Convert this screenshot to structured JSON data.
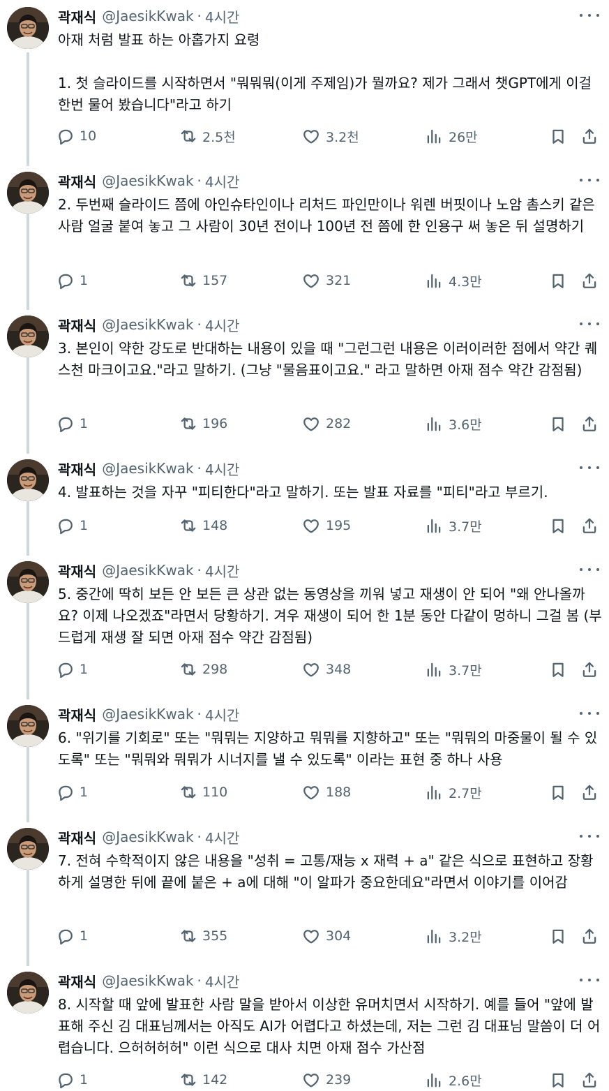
{
  "author": {
    "name": "곽재식",
    "handle": "@JaesikKwak",
    "separator": "·",
    "time": "4시간"
  },
  "icons": {
    "reply": "reply-icon",
    "retweet": "retweet-icon",
    "like": "heart-icon",
    "views": "views-bar-chart-icon",
    "bookmark": "bookmark-icon",
    "share": "share-icon",
    "more": "more-dots-icon"
  },
  "colors": {
    "text": "#0f1419",
    "muted": "#536471",
    "thread_line": "#cfd9de",
    "background": "#ffffff"
  },
  "tweets": [
    {
      "text": "아재 처럼 발표 하는 아홉가지 요령\n\n1. 첫 슬라이드를 시작하면서 \"뭐뭐뭐(이게 주제임)가 뭘까요? 제가 그래서 챗GPT에게 이걸 한번 물어 봤습니다\"라고 하기",
      "replies": "10",
      "retweets": "2.5천",
      "likes": "3.2천",
      "views": "26만"
    },
    {
      "text": "2. 두번째 슬라이드 쯤에 아인슈타인이나 리처드 파인만이나 워렌 버핏이나 노암 촘스키 같은 사람 얼굴 붙여 놓고 그 사람이 30년 전이나 100년 전 쯤에 한 인용구 써 놓은 뒤 설명하기",
      "replies": "1",
      "retweets": "157",
      "likes": "321",
      "views": "4.3만"
    },
    {
      "text": "3. 본인이 약한 강도로 반대하는 내용이 있을 때 \"그런그런 내용은 이러이러한 점에서 약간 퀘스천 마크이고요.\"라고 말하기. (그냥 \"물음표이고요.\" 라고 말하면 아재 점수 약간 감점됨)",
      "replies": "1",
      "retweets": "196",
      "likes": "282",
      "views": "3.6만"
    },
    {
      "text": "4. 발표하는 것을 자꾸 \"피티한다\"라고 말하기. 또는 발표 자료를 \"피티\"라고 부르기.",
      "replies": "1",
      "retweets": "148",
      "likes": "195",
      "views": "3.7만"
    },
    {
      "text": "5. 중간에 딱히 보든 안 보든 큰 상관 없는 동영상을 끼워 넣고 재생이 안 되어 \"왜 안나올까요? 이제 나오겠죠\"라면서 당황하기. 겨우 재생이 되어 한 1분 동안 다같이 멍하니 그걸 봄 (부드럽게 재생 잘 되면 아재 점수 약간 감점됨)",
      "replies": "1",
      "retweets": "298",
      "likes": "348",
      "views": "3.7만"
    },
    {
      "text": "6. \"위기를 기회로\" 또는 \"뭐뭐는 지양하고 뭐뭐를 지향하고\" 또는 \"뭐뭐의 마중물이 될 수 있도록\" 또는 \"뭐뭐와 뭐뭐가 시너지를 낼 수 있도록\" 이라는 표현 중 하나 사용",
      "replies": "1",
      "retweets": "110",
      "likes": "188",
      "views": "2.7만"
    },
    {
      "text": "7. 전혀 수학적이지 않은 내용을 \"성취 = 고통/재능 x 재력 + a\" 같은 식으로 표현하고 장황하게 설명한 뒤에 끝에 붙은 + a에 대해 \"이 알파가 중요한데요\"라면서 이야기를 이어감",
      "replies": "1",
      "retweets": "355",
      "likes": "304",
      "views": "3.2만"
    },
    {
      "text": "8. 시작할 때 앞에 발표한 사람 말을 받아서 이상한 유머치면서 시작하기. 예를 들어 \"앞에 발표해 주신 김 대표님께서는 아직도 AI가 어렵다고 하셨는데, 저는 그런 김 대표님 말씀이 더 어렵습니다. 으허허허허\" 이런 식으로 대사 치면 아재 점수 가산점",
      "replies": "1",
      "retweets": "142",
      "likes": "239",
      "views": "2.6만"
    }
  ]
}
